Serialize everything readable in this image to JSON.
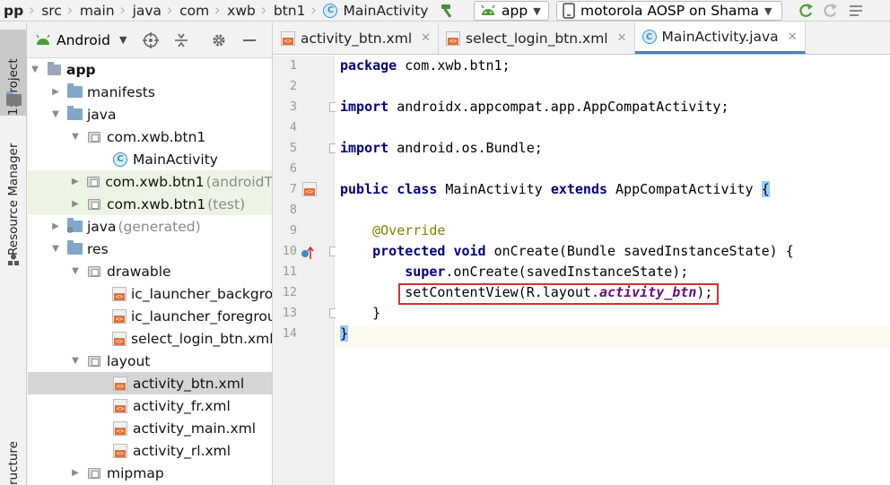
{
  "navbar": {
    "breadcrumbs": [
      "pp",
      "src",
      "main",
      "java",
      "com",
      "xwb",
      "btn1",
      "MainActivity"
    ],
    "run_config": "app",
    "device": "motorola AOSP on Shama"
  },
  "left_strip": {
    "project_tab": "1: Project",
    "resource_manager_tab": "Resource Manager",
    "structure_tab": "ructure"
  },
  "project_panel": {
    "view_selector": "Android",
    "tree": [
      {
        "label": "app",
        "suffix": "",
        "icon": "module-icon",
        "expanded": true
      },
      {
        "label": "manifests",
        "suffix": "",
        "icon": "folder-icon",
        "expanded": false
      },
      {
        "label": "java",
        "suffix": "",
        "icon": "folder-icon",
        "expanded": true
      },
      {
        "label": "com.xwb.btn1",
        "suffix": "",
        "icon": "package-icon",
        "expanded": true
      },
      {
        "label": "MainActivity",
        "suffix": "",
        "icon": "class-icon"
      },
      {
        "label": "com.xwb.btn1",
        "suffix": "(androidT",
        "icon": "package-icon",
        "expanded": false
      },
      {
        "label": "com.xwb.btn1",
        "suffix": "(test)",
        "icon": "package-icon",
        "expanded": false
      },
      {
        "label": "java",
        "suffix": "(generated)",
        "icon": "generated-folder-icon",
        "expanded": false
      },
      {
        "label": "res",
        "suffix": "",
        "icon": "folder-icon",
        "expanded": true
      },
      {
        "label": "drawable",
        "suffix": "",
        "icon": "package-icon",
        "expanded": true
      },
      {
        "label": "ic_launcher_backgrou",
        "suffix": "",
        "icon": "xml-file-icon"
      },
      {
        "label": "ic_launcher_foregrour",
        "suffix": "",
        "icon": "xml-file-icon"
      },
      {
        "label": "select_login_btn.xml",
        "suffix": "",
        "icon": "xml-file-icon"
      },
      {
        "label": "layout",
        "suffix": "",
        "icon": "package-icon",
        "expanded": true
      },
      {
        "label": "activity_btn.xml",
        "suffix": "",
        "icon": "xml-file-icon",
        "selected": true
      },
      {
        "label": "activity_fr.xml",
        "suffix": "",
        "icon": "xml-file-icon"
      },
      {
        "label": "activity_main.xml",
        "suffix": "",
        "icon": "xml-file-icon"
      },
      {
        "label": "activity_rl.xml",
        "suffix": "",
        "icon": "xml-file-icon"
      },
      {
        "label": "mipmap",
        "suffix": "",
        "icon": "package-icon",
        "expanded": false
      }
    ]
  },
  "editor": {
    "tabs": [
      {
        "label": "activity_btn.xml",
        "icon": "xml-file-icon",
        "active": false
      },
      {
        "label": "select_login_btn.xml",
        "icon": "xml-file-icon",
        "active": false
      },
      {
        "label": "MainActivity.java",
        "icon": "class-icon",
        "active": true
      }
    ],
    "line_numbers": [
      "1",
      "2",
      "3",
      "4",
      "5",
      "6",
      "7",
      "8",
      "9",
      "10",
      "11",
      "12",
      "13",
      "14"
    ],
    "code": {
      "l1_kw": "package",
      "l1_rest": " com.xwb.btn1;",
      "l3_kw": "import",
      "l3_rest": " androidx.appcompat.app.AppCompatActivity;",
      "l5_kw": "import",
      "l5_rest": " android.os.Bundle;",
      "l7_kw1": "public",
      "l7_kw2": "class",
      "l7_name": " MainActivity ",
      "l7_kw3": "extends",
      "l7_super": " AppCompatActivity ",
      "l7_brace": "{",
      "l9_ann": "@Override",
      "l10_kw1": "protected",
      "l10_kw2": "void",
      "l10_rest": " onCreate(Bundle savedInstanceState) {",
      "l11_kw": "super",
      "l11_rest": ".onCreate(savedInstanceState);",
      "l12_pre": "setContentView(R.layout.",
      "l12_field": "activity_btn",
      "l12_post": ");",
      "l13": "}",
      "l14": "}"
    }
  },
  "colors": {
    "keyword": "#000080",
    "annotation": "#808000",
    "field": "#660e7a",
    "highlight_box": "#d9302b",
    "active_tab_underline": "#4083c9"
  }
}
